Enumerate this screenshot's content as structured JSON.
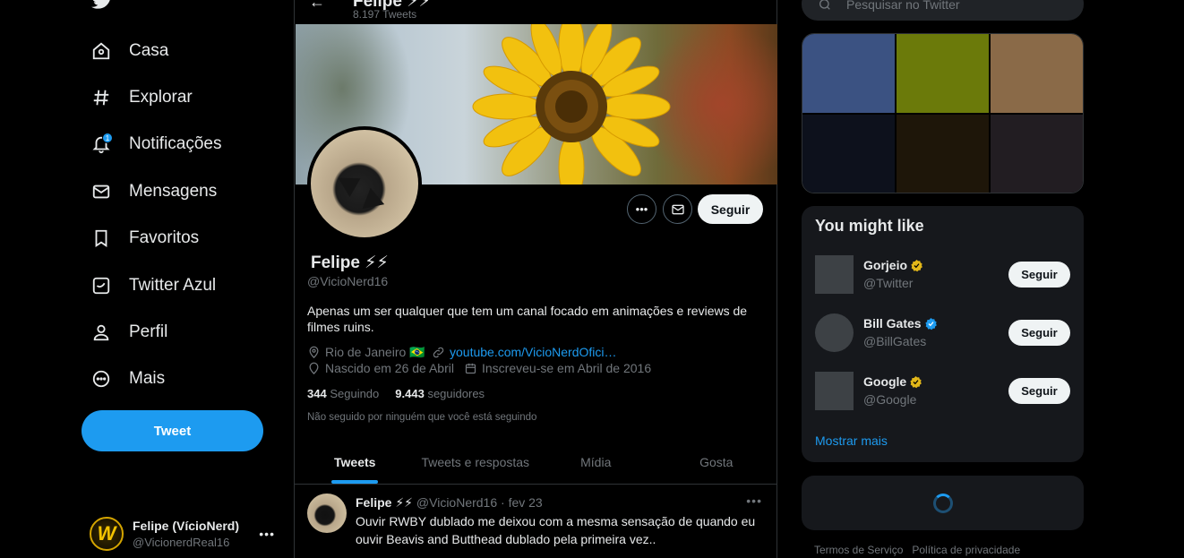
{
  "nav": {
    "items": [
      {
        "label": "Casa",
        "icon": "home-icon"
      },
      {
        "label": "Explorar",
        "icon": "hashtag-icon"
      },
      {
        "label": "Notificações",
        "icon": "bell-icon",
        "badge": "1"
      },
      {
        "label": "Mensagens",
        "icon": "envelope-icon"
      },
      {
        "label": "Favoritos",
        "icon": "bookmark-icon"
      },
      {
        "label": "Twitter Azul",
        "icon": "twitter-blue-icon"
      },
      {
        "label": "Perfil",
        "icon": "person-icon"
      },
      {
        "label": "Mais",
        "icon": "more-circle-icon"
      }
    ],
    "tweet_button": "Tweet",
    "account": {
      "name": "Felipe (VícioNerd)",
      "handle": "@VicionerdReal16",
      "avatar_letter": "W"
    }
  },
  "header": {
    "name": "Felipe ⚡⚡",
    "tweet_count": "8.197 Tweets"
  },
  "profile": {
    "name": "Felipe ⚡⚡",
    "handle": "@VicioNerd16",
    "follow_label": "Seguir",
    "bio": "Apenas um ser qualquer que tem um canal focado em animações e reviews de filmes ruins.",
    "location": "Rio de Janeiro 🇧🇷",
    "link": "youtube.com/VicioNerdOfici…",
    "birthday": "Nascido em 26 de Abril",
    "joined": "Inscreveu-se em Abril de 2016",
    "following_count": "344",
    "following_label": "Seguindo",
    "followers_count": "9.443",
    "followers_label": "seguidores",
    "followed_by": "Não seguido por ninguém que você está seguindo"
  },
  "tabs": [
    "Tweets",
    "Tweets e respostas",
    "Mídia",
    "Gosta"
  ],
  "tweet": {
    "name": "Felipe ⚡⚡",
    "meta": "@VicioNerd16 · fev 23",
    "text": "Ouvir RWBY dublado me deixou com a mesma sensação de quando eu ouvir Beavis and Butthead dublado pela primeira vez.."
  },
  "search": {
    "placeholder": "Pesquisar no Twitter"
  },
  "media_colors": [
    "#3b5282",
    "#6b7a0a",
    "#8a6a48",
    "#0d111c",
    "#1e1609",
    "#221d22"
  ],
  "suggestions": {
    "title": "You might like",
    "items": [
      {
        "name": "Gorjeio",
        "handle": "@Twitter",
        "verified": "gold",
        "button": "Seguir"
      },
      {
        "name": "Bill Gates",
        "handle": "@BillGates",
        "verified": "blue",
        "button": "Seguir"
      },
      {
        "name": "Google",
        "handle": "@Google",
        "verified": "gold",
        "button": "Seguir"
      }
    ],
    "show_more": "Mostrar mais"
  },
  "footer": {
    "terms": "Termos de Serviço",
    "privacy": "Política de privacidade"
  },
  "colors": {
    "accent": "#1d9bf0",
    "background": "#000000",
    "gold_check": "#e2b719"
  }
}
